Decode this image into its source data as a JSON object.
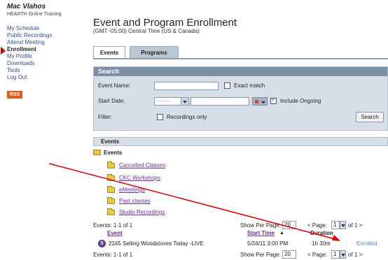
{
  "sidebar": {
    "user_name": "Mac Vlahos",
    "org_name": "HEARTH Online Training",
    "nav": [
      {
        "label": "My Schedule",
        "active": false
      },
      {
        "label": "Public Recordings",
        "active": false
      },
      {
        "label": "Attend Meeting",
        "active": false
      },
      {
        "label": "Enrollment",
        "active": true
      },
      {
        "label": "My Profile",
        "active": false
      },
      {
        "label": "Downloads",
        "active": false
      },
      {
        "label": "Tools",
        "active": false
      },
      {
        "label": "Log Out",
        "active": false
      }
    ],
    "rss_label": "RSS"
  },
  "page": {
    "title": "Event and Program Enrollment",
    "timezone": "(GMT -05:00) Central Time (US & Canada)"
  },
  "tabs": [
    {
      "label": "Events",
      "active": true
    },
    {
      "label": "Programs",
      "active": false
    }
  ],
  "search": {
    "header": "Search",
    "event_name_label": "Event Name:",
    "event_name_value": "",
    "exact_match_label": "Exact match",
    "exact_match_checked": false,
    "start_date_label": "Start Date:",
    "start_date_select": "--------",
    "start_date_value": "",
    "include_ongoing_label": "Include Ongoing",
    "include_ongoing_checked": true,
    "filter_label": "Filter:",
    "recordings_only_label": "Recordings only",
    "recordings_only_checked": false,
    "search_button": "Search"
  },
  "events": {
    "header": "Events",
    "root_folder": "Events",
    "folders": [
      "Cancelled Classes",
      "CKC Workshops",
      "eMeetings",
      "Past classes",
      "Studio Recordings"
    ],
    "pager_top": {
      "count_text": "Events: 1-1 of 1",
      "per_page_label": "Show Per Page:",
      "per_page": "20",
      "page_label": "< Page:",
      "page": "1",
      "of_text": "of 1 >"
    },
    "columns": {
      "event": "Event",
      "start_time": "Start Time",
      "sort_indicator": "▲",
      "duration": "Duration"
    },
    "rows": [
      {
        "icon": "S",
        "name": "2245 Selling Woodstoves Today -LIVE",
        "start": "5/24/11 3:00 PM",
        "duration": "1h 30m",
        "status": "Enrolled"
      }
    ],
    "pager_bottom": {
      "count_text": "Events: 1-1 of 1",
      "per_page_label": "Show Per Page:",
      "per_page": "20",
      "page_label": "< Page:",
      "page": "1",
      "of_text": "of 1 >"
    }
  },
  "colors": {
    "annotation": "#dd0000",
    "header_bar": "#7c8fa6",
    "panel": "#d6dee7",
    "folder_link": "#6b2c9c",
    "nav_link": "#2f4f8f",
    "rss": "#e05a1a"
  }
}
